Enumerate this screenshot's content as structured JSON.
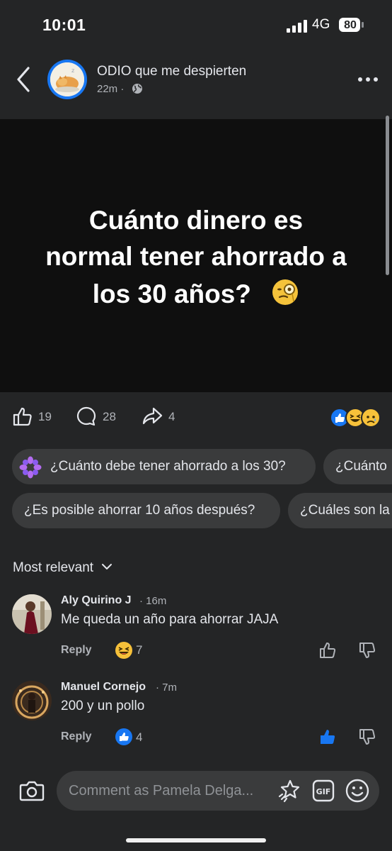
{
  "status_bar": {
    "time": "10:01",
    "network": "4G",
    "battery": "80"
  },
  "header": {
    "page_name": "ODIO que me despierten",
    "time": "22m ·"
  },
  "post": {
    "text_lines": [
      "Cuánto dinero es",
      "normal tener ahorrado a",
      "los 30 años?"
    ],
    "emoji_icon": "monocle-face-icon"
  },
  "actions": {
    "likes": "19",
    "comments": "28",
    "shares": "4"
  },
  "suggestions": {
    "row1": [
      "¿Cuánto debe tener ahorrado a los 30?",
      "¿Cuánto"
    ],
    "row2": [
      "¿Es posible ahorrar 10 años después?",
      "¿Cuáles son la"
    ]
  },
  "sort": {
    "label": "Most relevant"
  },
  "comments": [
    {
      "name": "Aly Quirino J",
      "time": "· 16m",
      "text": "Me queda un año para ahorrar JAJA",
      "reply": "Reply",
      "reaction_icon": "haha-icon",
      "count": "7"
    },
    {
      "name": "Manuel Cornejo",
      "time": "· 7m",
      "text": "200 y un pollo",
      "reply": "Reply",
      "reaction_icon": "like-icon",
      "count": "4"
    }
  ],
  "composer": {
    "placeholder": "Comment as Pamela Delga..."
  },
  "colors": {
    "accent": "#1877f2",
    "background": "#242526",
    "chip": "#3a3b3c",
    "muted": "#b0b3b8"
  }
}
